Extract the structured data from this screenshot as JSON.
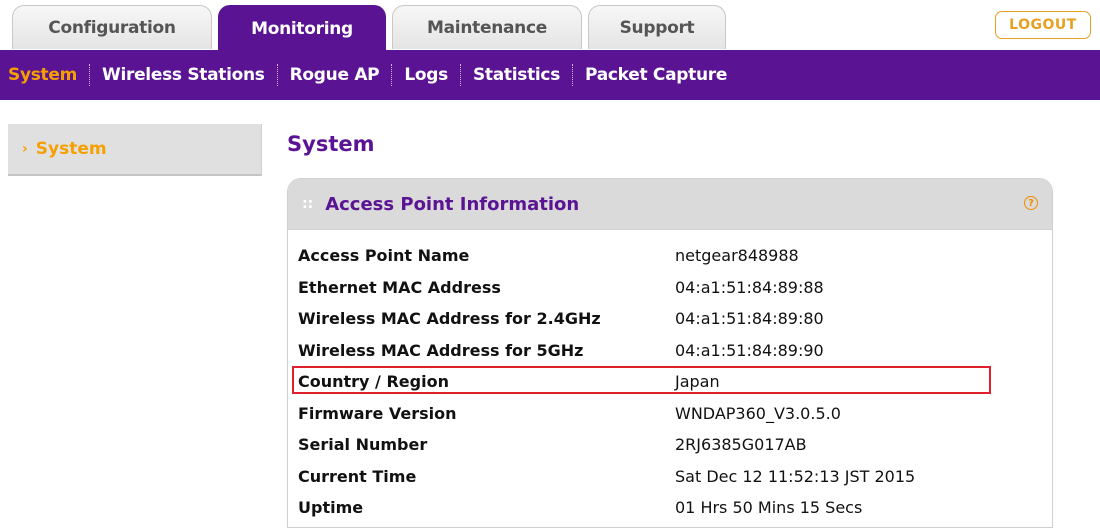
{
  "top_tabs": [
    {
      "label": "Configuration"
    },
    {
      "label": "Monitoring"
    },
    {
      "label": "Maintenance"
    },
    {
      "label": "Support"
    }
  ],
  "logout_label": "LOGOUT",
  "sub_nav": [
    {
      "label": "System"
    },
    {
      "label": "Wireless Stations"
    },
    {
      "label": "Rogue AP"
    },
    {
      "label": "Logs"
    },
    {
      "label": "Statistics"
    },
    {
      "label": "Packet Capture"
    }
  ],
  "side_menu": {
    "label": "System",
    "arrow_icon": "chevron-right-icon"
  },
  "page_title": "System",
  "panel": {
    "title": "Access Point Information",
    "help_icon": "help-icon",
    "rows": [
      {
        "label": "Access Point Name",
        "value": "netgear848988"
      },
      {
        "label": "Ethernet MAC Address",
        "value": "04:a1:51:84:89:88"
      },
      {
        "label": "Wireless MAC Address for 2.4GHz",
        "value": "04:a1:51:84:89:80"
      },
      {
        "label": "Wireless MAC Address for 5GHz",
        "value": "04:a1:51:84:89:90"
      },
      {
        "label": "Country / Region",
        "value": "Japan"
      },
      {
        "label": "Firmware Version",
        "value": "WNDAP360_V3.0.5.0"
      },
      {
        "label": "Serial Number",
        "value": "2RJ6385G017AB"
      },
      {
        "label": "Current Time",
        "value": "Sat Dec 12 11:52:13 JST 2015"
      },
      {
        "label": "Uptime",
        "value": "01 Hrs 50 Mins 15 Secs"
      }
    ]
  },
  "colors": {
    "brand_purple": "#5a1393",
    "accent_orange": "#f5a000",
    "highlight_red": "#e0202a",
    "panel_header_gray": "#dadada"
  }
}
